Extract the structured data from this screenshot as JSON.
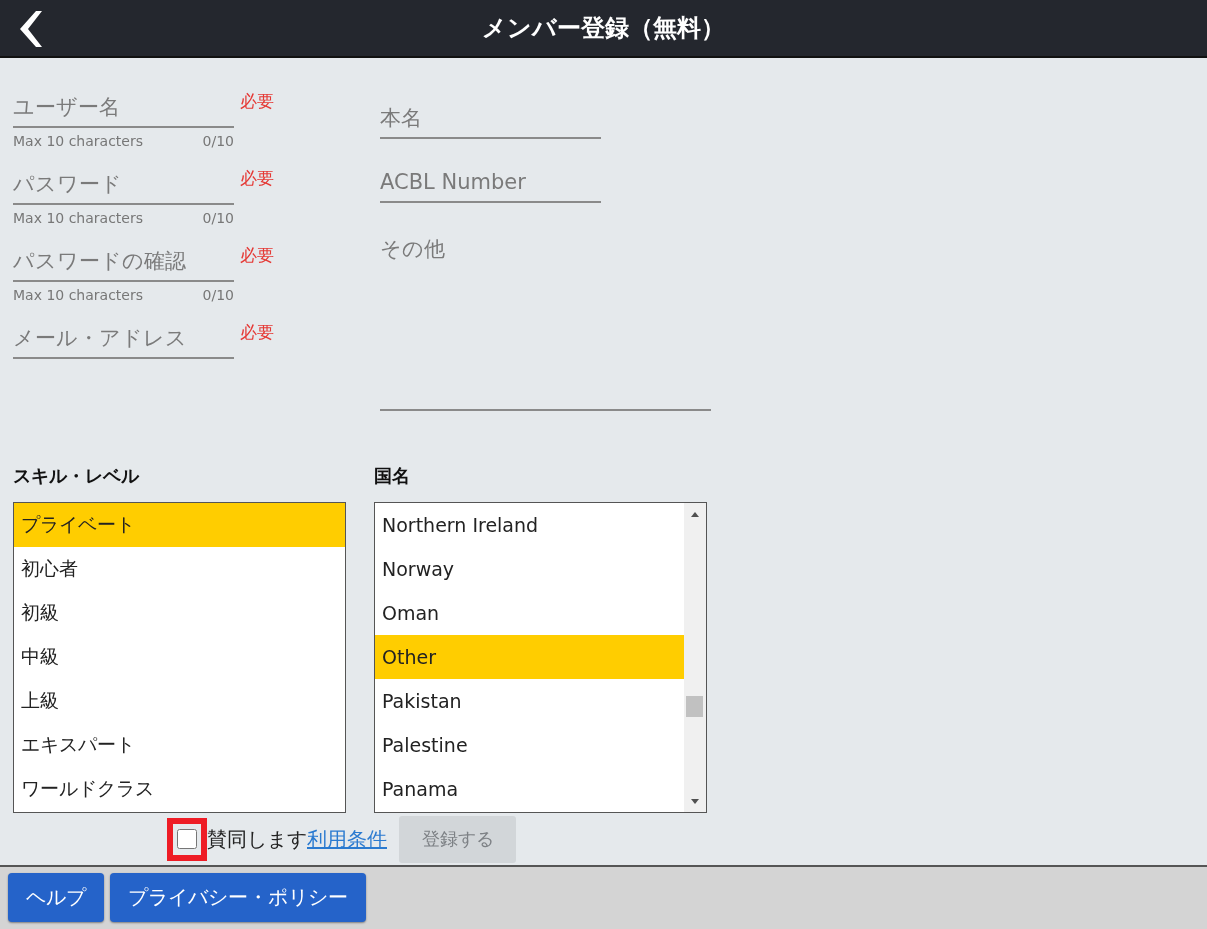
{
  "header": {
    "title": "メンバー登録（無料）"
  },
  "left_fields": [
    {
      "placeholder": "ユーザー名",
      "required_label": "必要",
      "hint": "Max 10 characters",
      "counter": "0/10"
    },
    {
      "placeholder": "パスワード",
      "required_label": "必要",
      "hint": "Max 10 characters",
      "counter": "0/10"
    },
    {
      "placeholder": "パスワードの確認",
      "required_label": "必要",
      "hint": "Max 10 characters",
      "counter": "0/10"
    },
    {
      "placeholder": "メール・アドレス",
      "required_label": "必要"
    }
  ],
  "right_fields": [
    {
      "kind": "input",
      "placeholder": "本名"
    },
    {
      "kind": "input",
      "placeholder": "ACBL Number"
    },
    {
      "kind": "textarea",
      "placeholder": "その他"
    }
  ],
  "skill_level": {
    "label": "スキル・レベル",
    "options": [
      {
        "text": "プライベート",
        "selected": true
      },
      {
        "text": "初心者",
        "selected": false
      },
      {
        "text": "初級",
        "selected": false
      },
      {
        "text": "中級",
        "selected": false
      },
      {
        "text": "上級",
        "selected": false
      },
      {
        "text": "エキスパート",
        "selected": false
      },
      {
        "text": "ワールドクラス",
        "selected": false
      }
    ]
  },
  "country": {
    "label": "国名",
    "options": [
      {
        "text": "Northern Ireland",
        "selected": false
      },
      {
        "text": "Norway",
        "selected": false
      },
      {
        "text": "Oman",
        "selected": false
      },
      {
        "text": "Other",
        "selected": true
      },
      {
        "text": "Pakistan",
        "selected": false
      },
      {
        "text": "Palestine",
        "selected": false
      },
      {
        "text": "Panama",
        "selected": false
      }
    ]
  },
  "agreement": {
    "checked": false,
    "highlighted": true,
    "text": "賛同します",
    "link": "利用条件"
  },
  "submit": {
    "label": "登録する",
    "disabled": true
  },
  "footer": {
    "buttons": [
      "ヘルプ",
      "プライバシー・ポリシー"
    ]
  }
}
